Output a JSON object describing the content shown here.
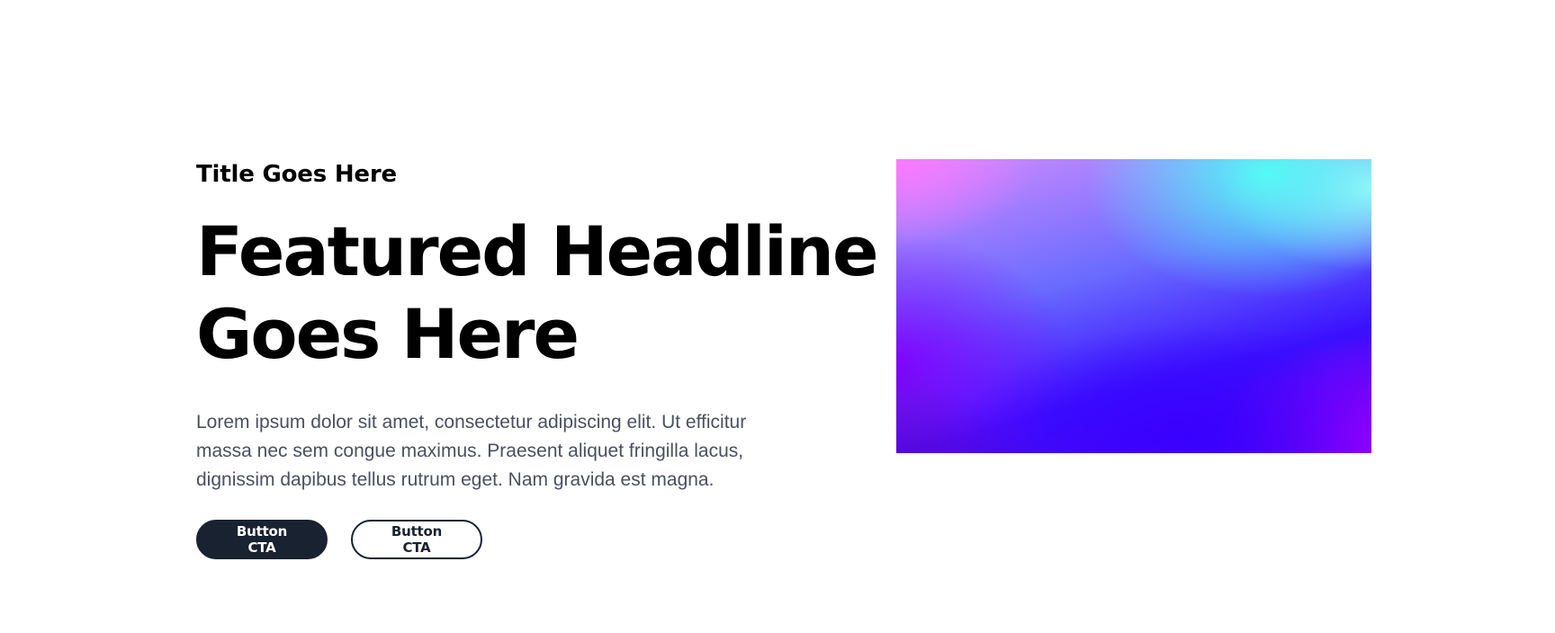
{
  "hero": {
    "eyebrow": "Title Goes Here",
    "headline": {
      "line1": "Featured Headline",
      "line2": "Goes Here"
    },
    "body": "Lorem ipsum dolor sit amet, consectetur adipiscing elit. Ut efficitur massa nec sem congue maximus. Praesent aliquet fringilla lacus, dignissim dapibus tellus rutrum eget. Nam gravida est magna.",
    "buttons": {
      "primary_label": "Button CTA",
      "secondary_label": "Button CTA"
    },
    "colors": {
      "text": "#000000",
      "body_text": "#4b5060",
      "button_dark": "#182230",
      "background": "#ffffff"
    },
    "media": {
      "description_icon": "gradient-image"
    }
  }
}
